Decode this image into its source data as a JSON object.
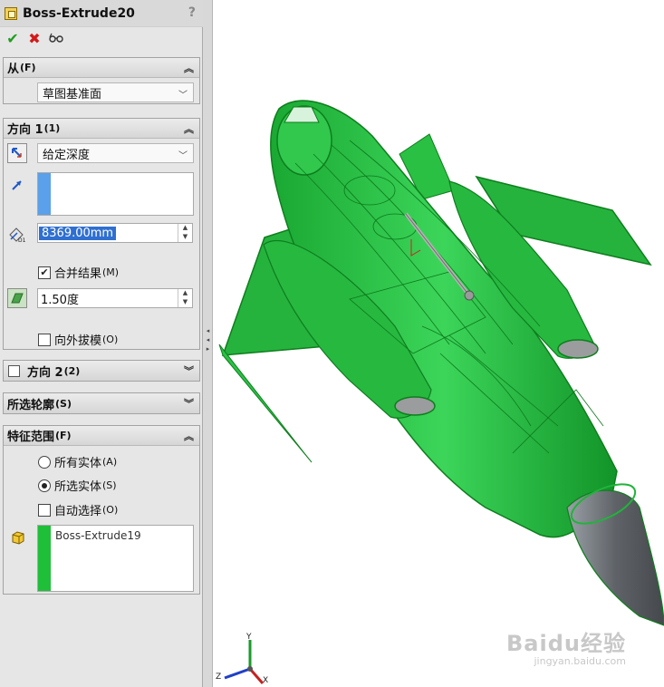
{
  "feature": {
    "title": "Boss-Extrude20",
    "help": "?"
  },
  "actions": {
    "ok": "✔",
    "cancel": "✖",
    "preview": "6∂"
  },
  "from": {
    "header": "从",
    "hotkey": "(F)",
    "start_condition": "草图基准面"
  },
  "direction1": {
    "header": "方向 1",
    "hotkey": "(1)",
    "end_condition": "给定深度",
    "depth_value": "8369.00mm",
    "merge_result_label": "合并结果",
    "merge_result_hotkey": "(M)",
    "merge_result_checked": true,
    "draft_angle": "1.50度",
    "draft_outward_label": "向外拔模",
    "draft_outward_hotkey": "(O)",
    "draft_outward_checked": false
  },
  "direction2": {
    "header": "方向 2",
    "hotkey": "(2)",
    "checked": false
  },
  "selected_contours": {
    "header": "所选轮廓",
    "hotkey": "(S)"
  },
  "feature_scope": {
    "header": "特征范围",
    "hotkey": "(F)",
    "all_bodies_label": "所有实体",
    "all_bodies_hotkey": "(A)",
    "selected_bodies_label": "所选实体",
    "selected_bodies_hotkey": "(S)",
    "selected_bodies_checked": true,
    "auto_select_label": "自动选择",
    "auto_select_hotkey": "(O)",
    "auto_select_checked": false,
    "bodies": [
      "Boss-Extrude19"
    ]
  },
  "triad": {
    "x": "X",
    "y": "Y",
    "z": "Z"
  },
  "watermark": {
    "brand": "Baidu经验",
    "url": "jingyan.baidu.com"
  },
  "colors": {
    "model_green": "#22b43a",
    "model_edge": "#0e8f1e",
    "nose_gray": "#6b6e72",
    "selection_blue": "#2f6fd0",
    "list_bar_blue": "#5aa0ea",
    "list_bar_green": "#1fbf3a"
  }
}
